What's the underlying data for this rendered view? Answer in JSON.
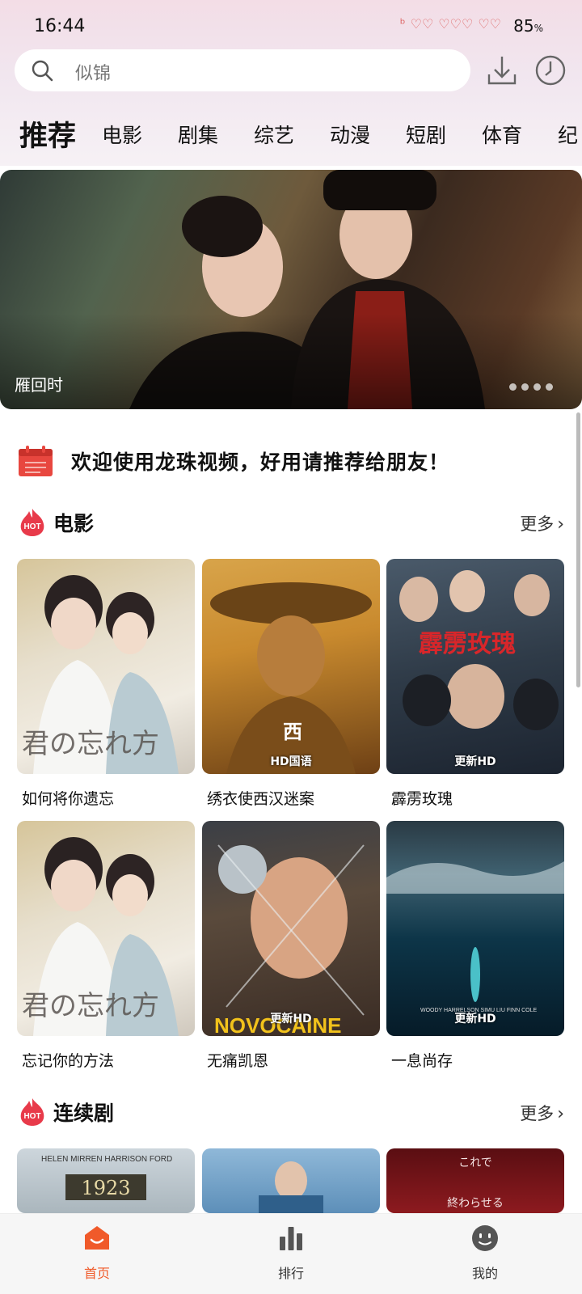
{
  "status": {
    "time": "16:44",
    "battery": "85",
    "battery_unit": "%"
  },
  "search": {
    "placeholder": "似锦"
  },
  "tabs": [
    {
      "label": "推荐",
      "active": true
    },
    {
      "label": "电影"
    },
    {
      "label": "剧集"
    },
    {
      "label": "综艺"
    },
    {
      "label": "动漫"
    },
    {
      "label": "短剧"
    },
    {
      "label": "体育"
    },
    {
      "label": "纪"
    }
  ],
  "banner": {
    "title": "雁回时",
    "dot_count": 4
  },
  "notice": {
    "text": "欢迎使用龙珠视频，好用请推荐给朋友！"
  },
  "sections": {
    "movies": {
      "title": "电影",
      "more": "更多",
      "hot_badge": "HOT",
      "items": [
        {
          "title": "如何将你遗忘",
          "badge": ""
        },
        {
          "title": "绣衣使西汉迷案",
          "badge": "HD国语"
        },
        {
          "title": "霹雳玫瑰",
          "badge": "更新HD"
        },
        {
          "title": "忘记你的方法",
          "badge": ""
        },
        {
          "title": "无痛凯恩",
          "badge": "更新HD"
        },
        {
          "title": "一息尚存",
          "badge": "更新HD"
        }
      ]
    },
    "series": {
      "title": "连续剧",
      "more": "更多",
      "hot_badge": "HOT"
    }
  },
  "nav": [
    {
      "label": "首页",
      "active": true
    },
    {
      "label": "排行"
    },
    {
      "label": "我的"
    }
  ],
  "colors": {
    "accent": "#f05a2a",
    "hot": "#e83a4a"
  }
}
